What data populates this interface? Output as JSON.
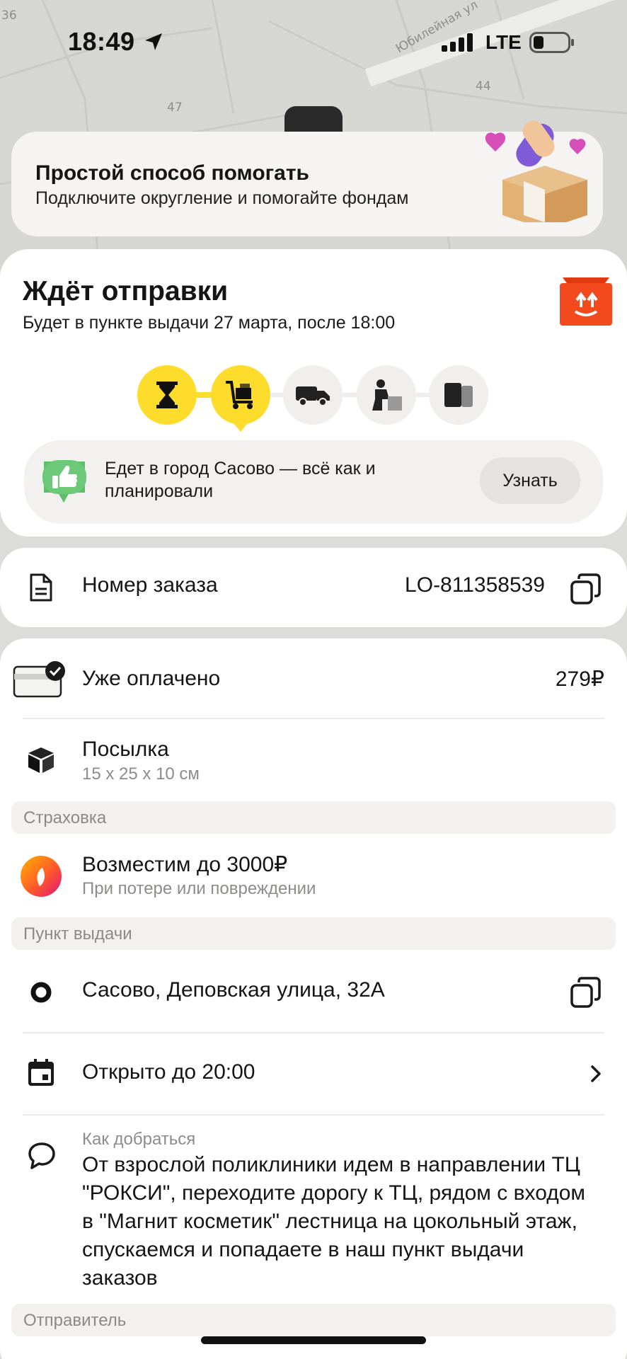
{
  "status_bar": {
    "time": "18:49",
    "network": "LTE",
    "icons": [
      "location-arrow-icon",
      "signal-icon",
      "battery-icon"
    ]
  },
  "map": {
    "street_label": "Юбилейная ул",
    "house_numbers": [
      "36",
      "47",
      "44"
    ]
  },
  "promo": {
    "title": "Простой способ помогать",
    "subtitle": "Подключите округление и помогайте фондам"
  },
  "shipment": {
    "status_title": "Ждёт отправки",
    "status_subtitle": "Будет в пункте выдачи 27 марта, после 18:00",
    "steps": [
      {
        "icon": "hourglass-icon",
        "active": true
      },
      {
        "icon": "cart-icon",
        "active": true,
        "current": true
      },
      {
        "icon": "truck-icon",
        "active": false
      },
      {
        "icon": "courier-icon",
        "active": false
      },
      {
        "icon": "pickup-box-icon",
        "active": false
      }
    ],
    "info_text": "Едет в город Сасово — всё как и планировали",
    "info_button": "Узнать"
  },
  "order": {
    "label": "Номер заказа",
    "number": "LO-811358539"
  },
  "details": {
    "paid_label": "Уже оплачено",
    "paid_amount": "279₽",
    "parcel_label": "Посылка",
    "parcel_size": "15 x 25 x 10 см",
    "insurance_header": "Страховка",
    "insurance_title": "Возместим до 3000₽",
    "insurance_sub": "При потере или повреждении",
    "pickup_header": "Пункт выдачи",
    "pickup_address": "Сасово, Деповская улица, 32А",
    "hours": "Открыто до 20:00",
    "directions_label": "Как добраться",
    "directions_text": "От взрослой поликлиники идем в направлении ТЦ \"РОКСИ\", переходите дорогу к ТЦ, рядом с входом в \"Магнит косметик\" лестница на цокольный этаж, спускаемся и попадаете в наш пункт выдачи заказов",
    "sender_header": "Отправитель"
  },
  "colors": {
    "accent_yellow": "#fddc2b",
    "brand_orange": "#f24a1d",
    "card_bg": "#ffffff",
    "muted_bg": "#f2f1ef"
  }
}
